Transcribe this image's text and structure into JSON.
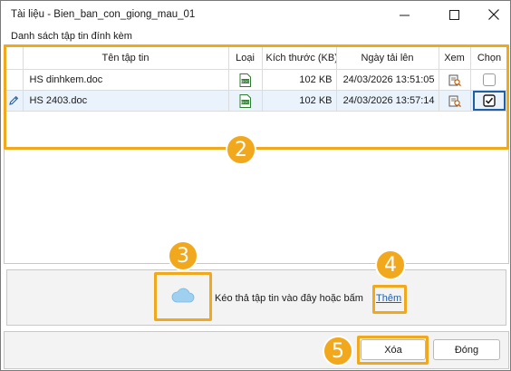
{
  "window": {
    "title": "Tài liệu - Bien_ban_con_giong_mau_01"
  },
  "section": {
    "title": "Danh sách tập tin đính kèm"
  },
  "grid": {
    "columns": {
      "name": "Tên tập tin",
      "type": "Loại",
      "size": "Kích thước (KB)",
      "date": "Ngày tải lên",
      "view": "Xem",
      "select": "Chọn"
    },
    "rows": [
      {
        "name": "HS dinhkem.doc",
        "size": "102 KB",
        "date": "24/03/2026 13:51:05",
        "checked": false,
        "editing": false
      },
      {
        "name": "HS 2403.doc",
        "size": "102 KB",
        "date": "24/03/2026 13:57:14",
        "checked": true,
        "editing": true
      }
    ]
  },
  "dropzone": {
    "text": "Kéo thả tập tin vào đây hoặc bấm",
    "link": "Thêm"
  },
  "footer": {
    "delete_label": "Xóa",
    "close_label": "Đóng"
  },
  "annotations": [
    "2",
    "3",
    "4",
    "5"
  ],
  "colors": {
    "highlight": "#f2a81d",
    "link": "#1f5fa8",
    "selected_row": "#eaf2fb"
  }
}
